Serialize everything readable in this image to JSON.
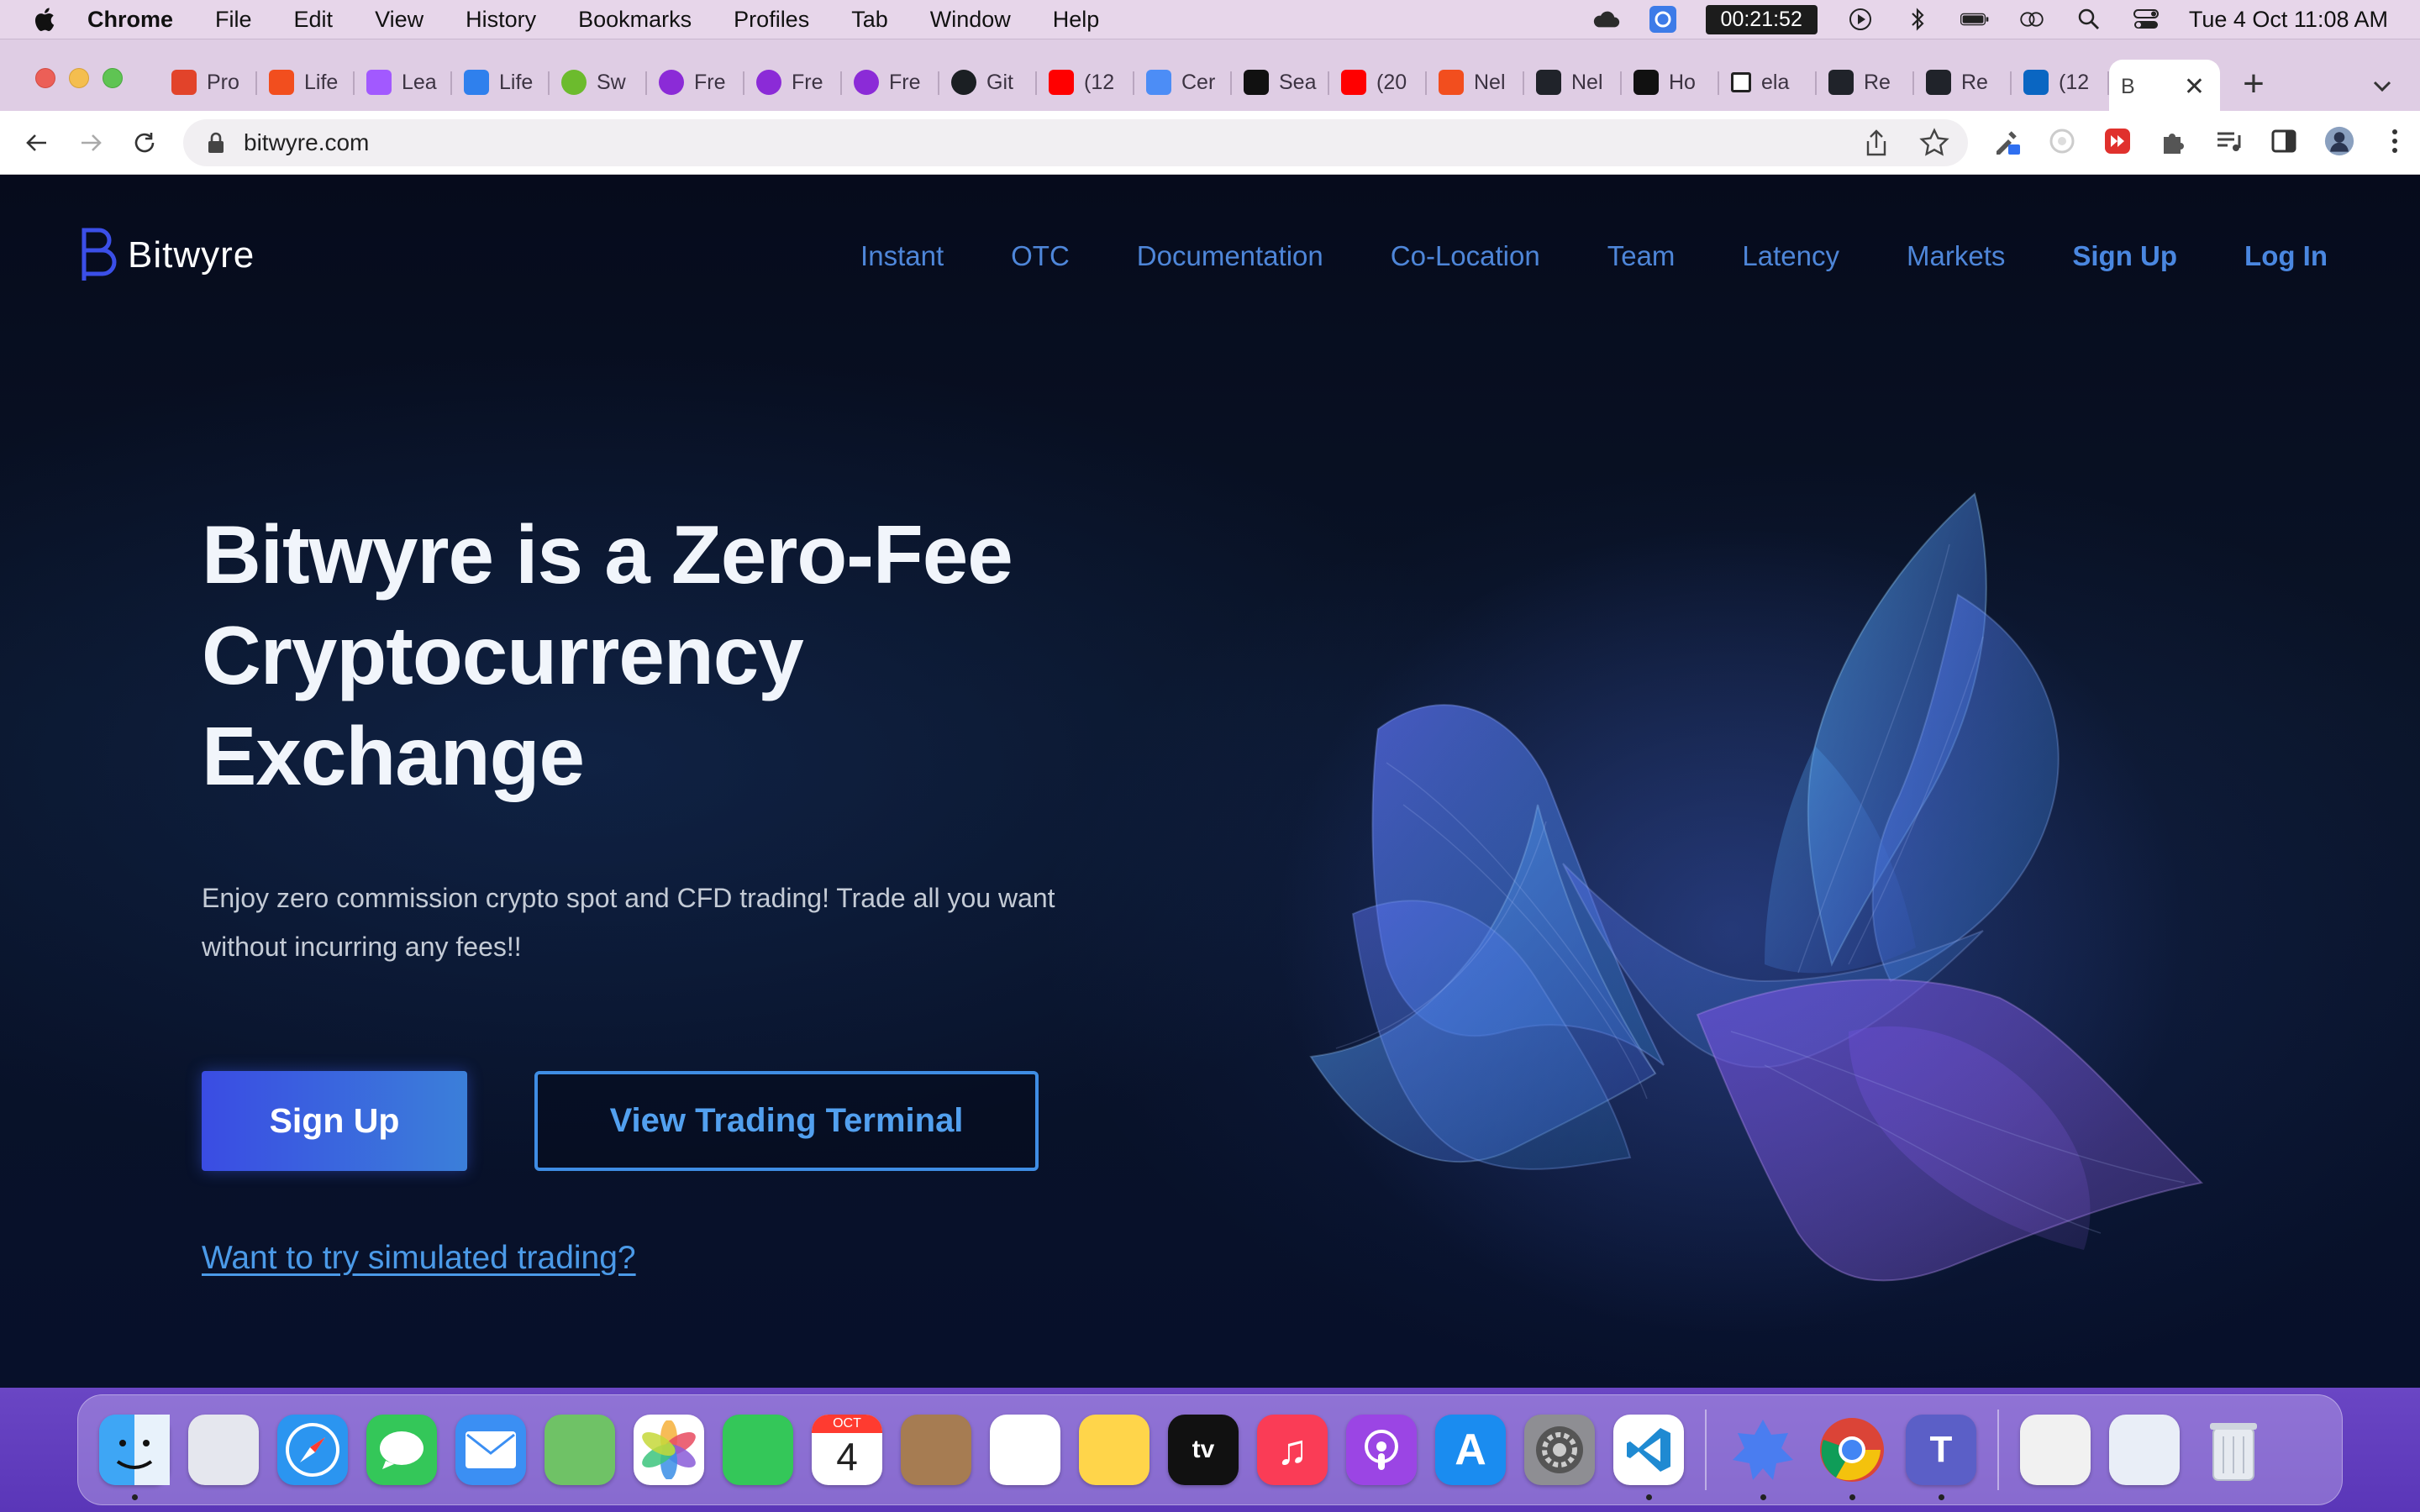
{
  "menubar": {
    "app_name": "Chrome",
    "menus": [
      "File",
      "Edit",
      "View",
      "History",
      "Bookmarks",
      "Profiles",
      "Tab",
      "Window",
      "Help"
    ],
    "timer": "00:21:52",
    "clock": "Tue 4 Oct  11:08 AM"
  },
  "browser": {
    "tabs": [
      {
        "label": "Pro",
        "icon": "gitlab-icon",
        "color": "#e2432a"
      },
      {
        "label": "Life",
        "icon": "figma-icon",
        "color": "#f24e1e"
      },
      {
        "label": "Lea",
        "icon": "figma-icon",
        "color": "#a259ff"
      },
      {
        "label": "Life",
        "icon": "vscode-icon",
        "color": "#2f80ed"
      },
      {
        "label": "Sw",
        "icon": "swagger-icon",
        "color": "#6cbb2d"
      },
      {
        "label": "Fre",
        "icon": "udemy-icon",
        "color": "#8b2bd7"
      },
      {
        "label": "Fre",
        "icon": "udemy-icon",
        "color": "#8b2bd7"
      },
      {
        "label": "Fre",
        "icon": "udemy-icon",
        "color": "#8b2bd7"
      },
      {
        "label": "Git",
        "icon": "github-icon",
        "color": "#1b1f23"
      },
      {
        "label": "(12",
        "icon": "youtube-icon",
        "color": "#ff0000"
      },
      {
        "label": "Cer",
        "icon": "gemini-icon",
        "color": "#4c8df6"
      },
      {
        "label": "Sea",
        "icon": "algolia-icon",
        "color": "#111111"
      },
      {
        "label": "(20",
        "icon": "youtube-icon",
        "color": "#ff0000"
      },
      {
        "label": "Nel",
        "icon": "figma-icon",
        "color": "#f24e1e"
      },
      {
        "label": "Nel",
        "icon": "react-icon",
        "color": "#20232a"
      },
      {
        "label": "Ho",
        "icon": "algolia-icon",
        "color": "#111111"
      },
      {
        "label": "ela",
        "icon": "square-icon",
        "color": "#ffffff"
      },
      {
        "label": "Re",
        "icon": "react-icon",
        "color": "#20232a"
      },
      {
        "label": "Re",
        "icon": "react-icon",
        "color": "#20232a"
      },
      {
        "label": "(12",
        "icon": "linkedin-icon",
        "color": "#0a66c2"
      }
    ],
    "active_tab": {
      "label": "B"
    },
    "url": "bitwyre.com"
  },
  "page": {
    "brand": "Bitwyre",
    "nav": [
      "Instant",
      "OTC",
      "Documentation",
      "Co-Location",
      "Team",
      "Latency",
      "Markets"
    ],
    "nav_signup": "Sign Up",
    "nav_login": "Log In",
    "hero_title_lines": [
      "Bitwyre is a Zero-Fee",
      "Cryptocurrency",
      "Exchange"
    ],
    "hero_subtitle": "Enjoy zero commission crypto spot and CFD trading! Trade all you want without incurring any fees!!",
    "signup_button": "Sign Up",
    "terminal_button": "View Trading Terminal",
    "simulated_link": "Want to try simulated trading?"
  },
  "dock": {
    "calendar_month": "OCT",
    "calendar_day": "4",
    "apps": [
      {
        "name": "finder-icon",
        "color": "#3ea6f5",
        "running": true
      },
      {
        "name": "launchpad-icon",
        "color": "#e5e7ee",
        "running": false
      },
      {
        "name": "safari-icon",
        "color": "#2b95f0",
        "running": false
      },
      {
        "name": "messages-icon",
        "color": "#34c759",
        "running": false
      },
      {
        "name": "mail-icon",
        "color": "#3b8ff3",
        "running": false
      },
      {
        "name": "maps-icon",
        "color": "#6fc266",
        "running": false
      },
      {
        "name": "photos-icon",
        "color": "#ffffff",
        "running": false
      },
      {
        "name": "facetime-icon",
        "color": "#34c759",
        "running": false
      },
      {
        "name": "calendar-icon",
        "color": "#ffffff",
        "running": false
      },
      {
        "name": "contacts-icon",
        "color": "#a67c52",
        "running": false
      },
      {
        "name": "reminders-icon",
        "color": "#ffffff",
        "running": false
      },
      {
        "name": "notes-icon",
        "color": "#ffd54a",
        "running": false
      },
      {
        "name": "apple-tv-icon",
        "color": "#111111",
        "running": false
      },
      {
        "name": "music-icon",
        "color": "#fa3c56",
        "running": false
      },
      {
        "name": "podcasts-icon",
        "color": "#9b45e4",
        "running": false
      },
      {
        "name": "app-store-icon",
        "color": "#1a8cf0",
        "running": false
      },
      {
        "name": "system-preferences-icon",
        "color": "#8e8e93",
        "running": false
      },
      {
        "name": "vscode-icon",
        "color": "#ffffff",
        "running": true
      },
      {
        "name": "separator",
        "color": "",
        "running": false
      },
      {
        "name": "cloud-app-icon",
        "color": "#4a7df0",
        "running": true
      },
      {
        "name": "chrome-icon",
        "color": "#ffffff",
        "running": true
      },
      {
        "name": "teams-icon",
        "color": "#5b5fc7",
        "running": true
      },
      {
        "name": "separator",
        "color": "",
        "running": false
      },
      {
        "name": "document-stack-icon",
        "color": "#f1f1f1",
        "running": false
      },
      {
        "name": "downloads-stack-icon",
        "color": "#e9eef7",
        "running": false
      },
      {
        "name": "trash-icon",
        "color": "#dfe3ea",
        "running": false
      }
    ]
  }
}
